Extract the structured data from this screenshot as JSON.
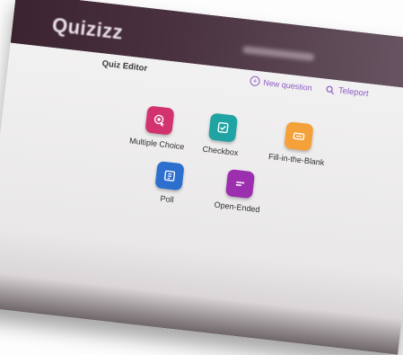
{
  "app": {
    "brand": "Quizizz"
  },
  "editor": {
    "title": "Quiz Editor",
    "new_question_label": "New question",
    "teleport_label": "Teleport"
  },
  "question_types": [
    {
      "label": "Multiple Choice",
      "color": "#d2326e",
      "icon": "radio-select-icon"
    },
    {
      "label": "Checkbox",
      "color": "#1fa3a3",
      "icon": "checkbox-icon"
    },
    {
      "label": "Fill-in-the-Blank",
      "color": "#f4a13a",
      "icon": "blank-box-icon"
    },
    {
      "label": "Poll",
      "color": "#2d6fcf",
      "icon": "poll-icon"
    },
    {
      "label": "Open-Ended",
      "color": "#9b2fae",
      "icon": "text-lines-icon"
    }
  ]
}
